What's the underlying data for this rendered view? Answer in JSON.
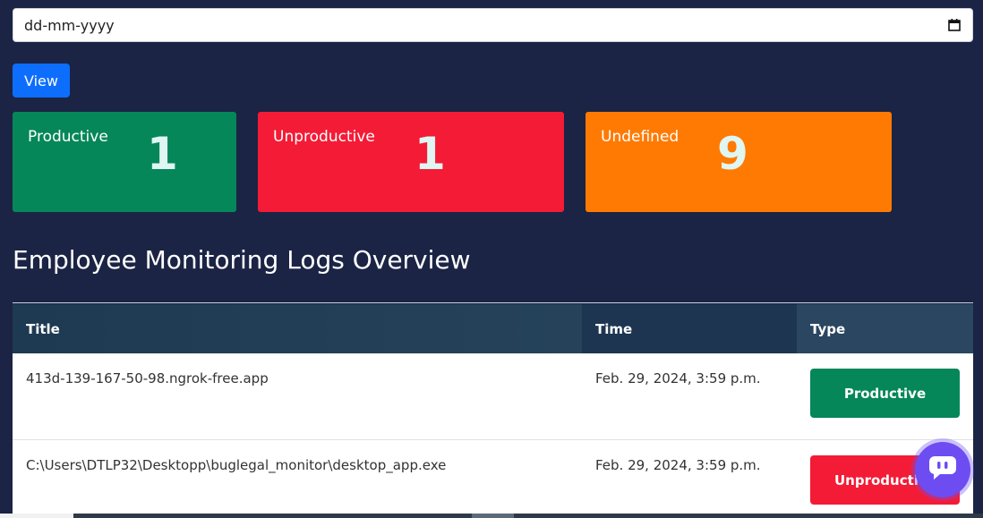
{
  "date_filter": {
    "value": "dd-mm-yyyy",
    "icon": "calendar-icon"
  },
  "view_button": {
    "label": "View",
    "color": "#0d6efd"
  },
  "summary_cards": [
    {
      "label": "Productive",
      "count": "1",
      "color": "#05875a"
    },
    {
      "label": "Unproductive",
      "count": "1",
      "color": "#f41b36"
    },
    {
      "label": "Undefined",
      "count": "9",
      "color": "#ff7a02"
    }
  ],
  "section_title": "Employee Monitoring Logs Overview",
  "table": {
    "headers": {
      "title": "Title",
      "time": "Time",
      "type": "Type"
    },
    "rows": [
      {
        "title": "413d-139-167-50-98.ngrok-free.app",
        "time": "Feb. 29, 2024, 3:59 p.m.",
        "type": "Productive",
        "type_color": "#05875a"
      },
      {
        "title": "C:\\Users\\DTLP32\\Desktopp\\buglegal_monitor\\desktop_app.exe",
        "time": "Feb. 29, 2024, 3:59 p.m.",
        "type": "Unproductive",
        "type_color": "#f41b36"
      }
    ]
  },
  "chat_widget": {
    "icon": "chat-bubble-icon",
    "color": "#6d4df2"
  },
  "colors": {
    "background": "#1b2444"
  }
}
